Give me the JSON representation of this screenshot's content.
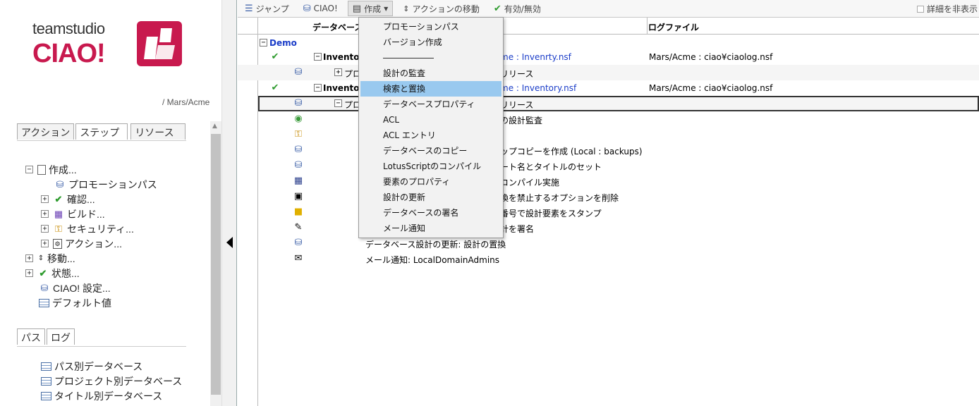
{
  "logo": {
    "company": "teamstudio",
    "product": "CIAO!"
  },
  "location": "/ Mars/Acme",
  "left_tabs": [
    "アクション",
    "ステップ",
    "リソース"
  ],
  "left_tabs_active": "ステップ",
  "steps_tree": [
    {
      "label": "作成...",
      "toggle": "⊟",
      "icon": "doc",
      "level": 0
    },
    {
      "label": "プロモーションパス",
      "toggle": "",
      "icon": "db",
      "level": 1
    },
    {
      "label": "確認...",
      "toggle": "+",
      "icon": "chk",
      "level": 1
    },
    {
      "label": "ビルド...",
      "toggle": "+",
      "icon": "build",
      "level": 1
    },
    {
      "label": "セキュリティ...",
      "toggle": "+",
      "icon": "sec",
      "level": 1
    },
    {
      "label": "アクション...",
      "toggle": "+",
      "icon": "act",
      "level": 1
    },
    {
      "label": "移動...",
      "toggle": "+",
      "icon": "move",
      "level": 0
    },
    {
      "label": "状態...",
      "toggle": "+",
      "icon": "chk",
      "level": 0
    },
    {
      "label": "CIAO! 設定...",
      "toggle": "",
      "icon": "db",
      "level": 0
    },
    {
      "label": "デフォルト値",
      "toggle": "",
      "icon": "tbl",
      "level": 0
    }
  ],
  "bottom_tabs": [
    "パス",
    "ログ"
  ],
  "views": [
    "パス別データベース",
    "プロジェクト別データベース",
    "タイトル別データベース"
  ],
  "toolbar": {
    "jump": "ジャンプ",
    "ciao": "CIAO!",
    "create": "作成",
    "move_action": "アクションの移動",
    "enable": "有効/無効",
    "hide_details": "詳細を非表示"
  },
  "columns": {
    "database": "データベース",
    "logfile": "ログファイル"
  },
  "rows": [
    {
      "kind": "group",
      "text": "Demo"
    },
    {
      "kind": "db",
      "name": "Invento",
      "path": "me : Invenrty.nsf",
      "log": "Mars/Acme : ciao¥ciaolog.nsf"
    },
    {
      "kind": "release",
      "name": "プロ",
      "text": "リリース"
    },
    {
      "kind": "db",
      "name": "Invento",
      "path": "me : Inventory.nsf",
      "log": "Mars/Acme : ciao¥ciaolog.nsf"
    },
    {
      "kind": "release",
      "name": "プロ",
      "text": "リリース"
    },
    {
      "kind": "step",
      "text": "の設計監査"
    },
    {
      "kind": "step",
      "text": ""
    },
    {
      "kind": "step",
      "text": "ップコピーを作成 (Local : backups)"
    },
    {
      "kind": "step",
      "text": "ート名とタイトルのセット"
    },
    {
      "kind": "step",
      "text": "コンパイル実施"
    },
    {
      "kind": "step",
      "text": "換を禁止するオプションを削除"
    },
    {
      "kind": "step",
      "text": "番号で設計要素をスタンプ"
    },
    {
      "kind": "step",
      "text": "計を署名"
    },
    {
      "kind": "step",
      "text": "データベース設計の更新: 設計の置換"
    },
    {
      "kind": "step",
      "text": "メール通知: LocalDomainAdmins"
    }
  ],
  "menu": [
    "プロモーションパス",
    "バージョン作成",
    "---",
    "設計の監査",
    "検索と置換",
    "データベースプロパティ",
    "ACL",
    "ACL エントリ",
    "データベースのコピー",
    "LotusScriptのコンパイル",
    "要素のプロパティ",
    "設計の更新",
    "データベースの署名",
    "メール通知"
  ],
  "menu_highlighted": "検索と置換",
  "colors": {
    "brand": "#c8194e",
    "link": "#1a3cc8",
    "highlight": "#99c9ef"
  }
}
